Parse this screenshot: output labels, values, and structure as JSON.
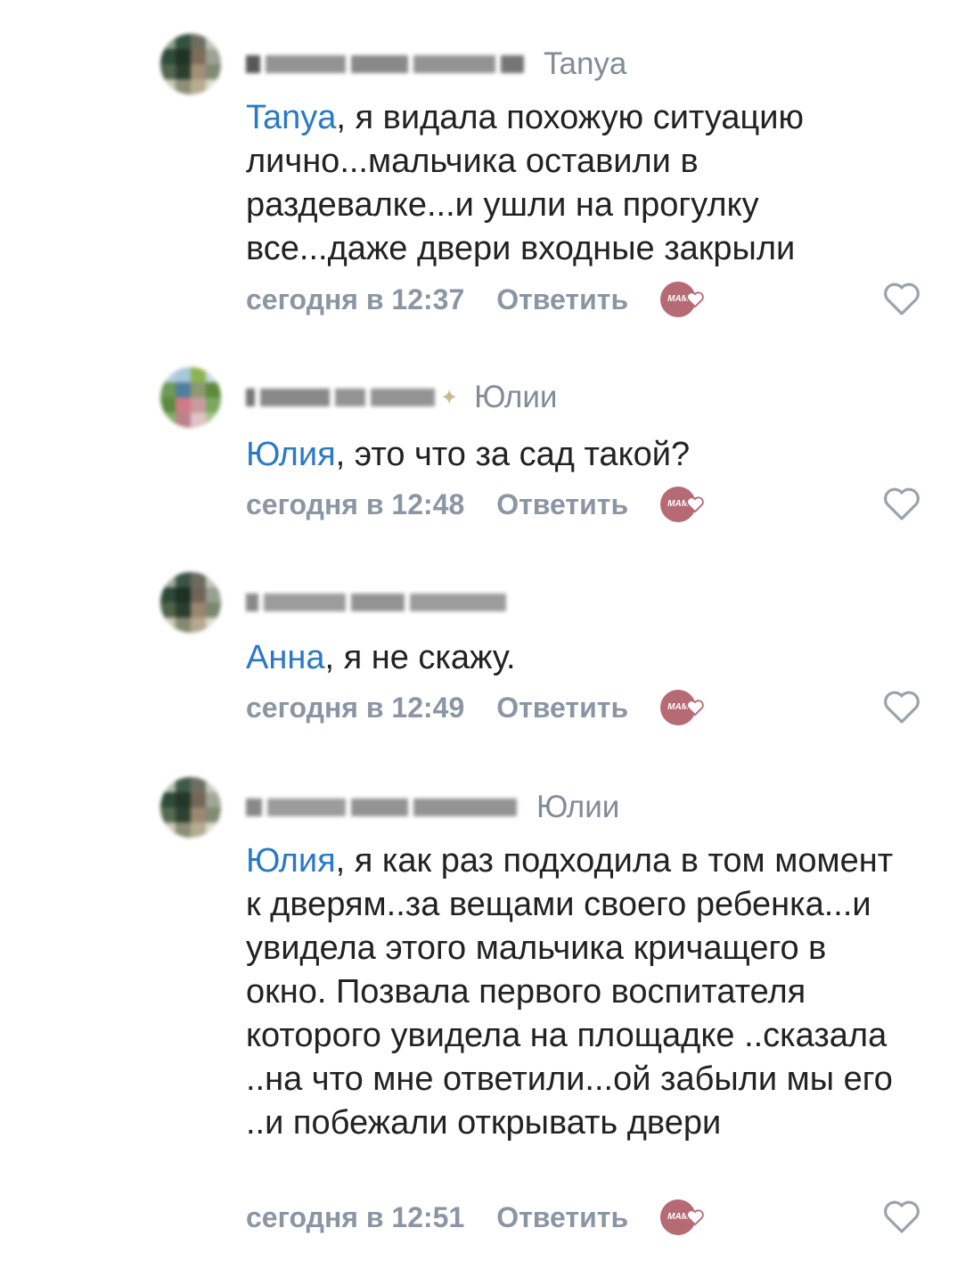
{
  "comments": [
    {
      "reply_to": "Tanya",
      "mention": "Tanya",
      "text": ", я видала похожую ситуацию лично...мальчика оставили в раздевалке...и ушли на прогулку все...даже двери входные закрыли",
      "date": "сегодня в 12:37",
      "reply_label": "Ответить"
    },
    {
      "reply_to": "Юлии",
      "mention": "Юлия",
      "text": ", это что за сад такой?",
      "date": "сегодня в 12:48",
      "reply_label": "Ответить"
    },
    {
      "reply_to": "",
      "mention": "Анна",
      "text": ", я не скажу.",
      "date": "сегодня в 12:49",
      "reply_label": "Ответить"
    },
    {
      "reply_to": "Юлии",
      "mention": "Юлия",
      "text": ", я как раз подходила в том момент к дверям..за вещами своего ребенка...и увидела этого мальчика кричащего в окно. Позвала первого воспитателя которого увидела на площадке ..сказала ..на что мне ответили...ой забыли мы его ..и побежали открывать двери",
      "date": "сегодня в 12:51",
      "reply_label": "Ответить"
    }
  ],
  "icons": {
    "reaction": "reaction-sticker-icon",
    "like": "heart-outline-icon"
  },
  "colors": {
    "mention": "#2a79c9",
    "meta": "#8b96a4",
    "reaction": "#b66a74"
  }
}
